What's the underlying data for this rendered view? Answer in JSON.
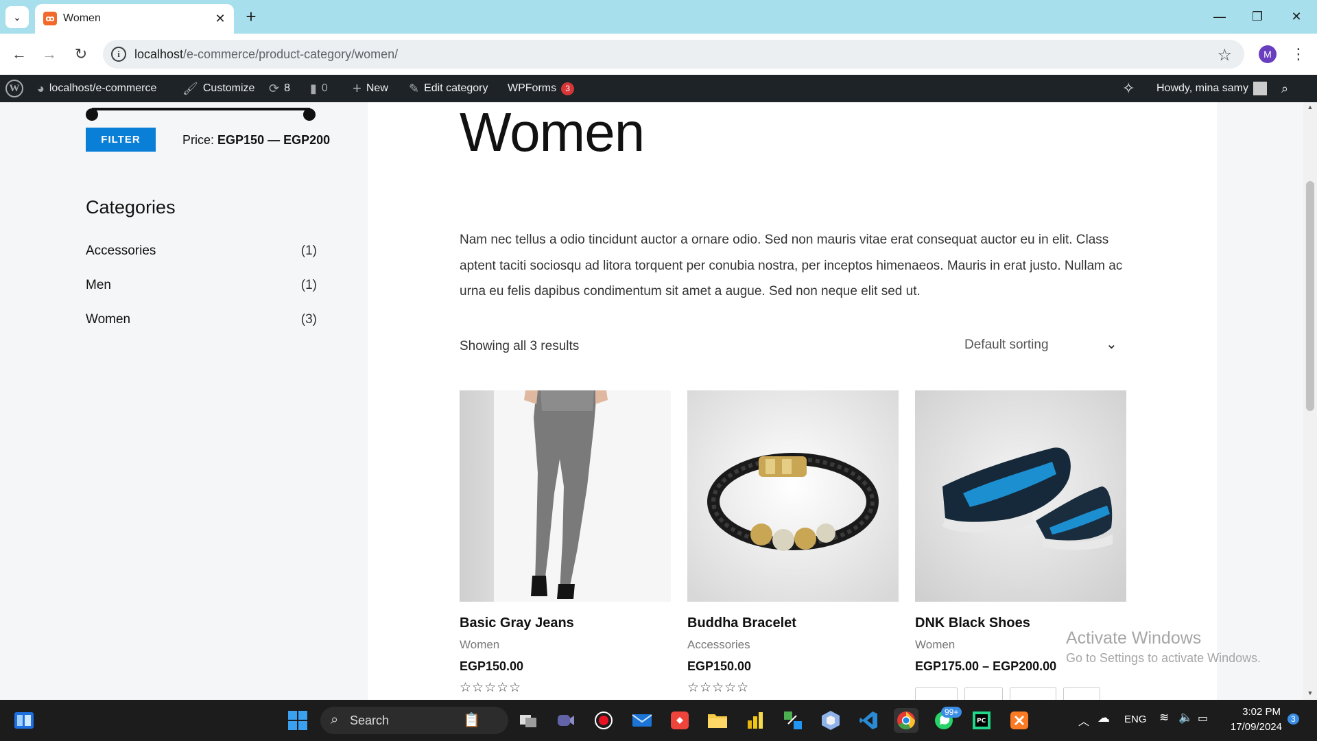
{
  "browser": {
    "tab_title": "Women",
    "url_host": "localhost",
    "url_path": "/e-commerce/product-category/women/",
    "profile_initial": "M"
  },
  "adminbar": {
    "site": "localhost/e-commerce",
    "customize": "Customize",
    "updates_count": "8",
    "comments_count": "0",
    "new": "New",
    "edit_category": "Edit category",
    "wpforms": "WPForms",
    "wpforms_badge": "3",
    "howdy": "Howdy, mina samy"
  },
  "sidebar": {
    "filter_button": "FILTER",
    "price_prefix": "Price:",
    "price_min": "EGP150",
    "price_sep": "—",
    "price_max": "EGP200",
    "categories_title": "Categories",
    "categories": [
      {
        "name": "Accessories",
        "count": "(1)"
      },
      {
        "name": "Men",
        "count": "(1)"
      },
      {
        "name": "Women",
        "count": "(3)"
      }
    ]
  },
  "main": {
    "heading": "Women",
    "description": "Nam nec tellus a odio tincidunt auctor a ornare odio. Sed non mauris vitae erat consequat auctor eu in elit. Class aptent taciti sociosqu ad litora torquent per conubia nostra, per inceptos himenaeos. Mauris in erat justo. Nullam ac urna eu felis dapibus condimentum sit amet a augue. Sed non neque elit sed ut.",
    "result_count": "Showing all 3 results",
    "sorting": "Default sorting",
    "products": [
      {
        "title": "Basic Gray Jeans",
        "category": "Women",
        "price": "EGP150.00",
        "rating": "☆☆☆☆☆"
      },
      {
        "title": "Buddha Bracelet",
        "category": "Accessories",
        "price": "EGP150.00",
        "rating": "☆☆☆☆☆"
      },
      {
        "title": "DNK Black Shoes",
        "category": "Women",
        "price": "EGP175.00 – EGP200.00"
      }
    ]
  },
  "watermark": {
    "line1": "Activate Windows",
    "line2": "Go to Settings to activate Windows."
  },
  "taskbar": {
    "search": "Search",
    "whatsapp_badge": "99+",
    "lang": "ENG",
    "time": "3:02 PM",
    "date": "17/09/2024",
    "notifications": "3"
  },
  "icons": {
    "accent": "#0a7fd8",
    "adminbar_bg": "#1d2327",
    "tabstrip_bg": "#a8dfed"
  }
}
